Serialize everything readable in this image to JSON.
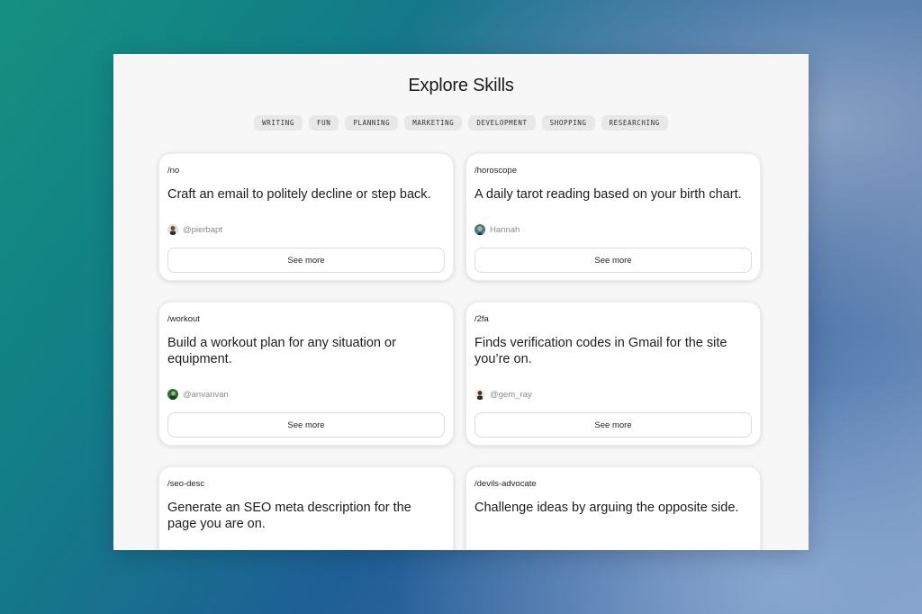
{
  "page": {
    "title": "Explore Skills"
  },
  "tags": [
    "WRITING",
    "FUN",
    "PLANNING",
    "MARKETING",
    "DEVELOPMENT",
    "SHOPPING",
    "RESEARCHING"
  ],
  "see_more_label": "See more",
  "cards": [
    {
      "command": "/no",
      "description": "Craft an email to politely decline or step back.",
      "author": "@pierbapt"
    },
    {
      "command": "/horoscope",
      "description": "A daily tarot reading based on your birth chart.",
      "author": "Hannah"
    },
    {
      "command": "/workout",
      "description": "Build a workout plan for any situation or equipment.",
      "author": "@anvanvan"
    },
    {
      "command": "/2fa",
      "description": "Finds verification codes in Gmail for the site you’re on.",
      "author": "@gem_ray"
    },
    {
      "command": "/seo-desc",
      "description": "Generate an SEO meta description for the page you are on.",
      "author": ""
    },
    {
      "command": "/devils-advocate",
      "description": "Challenge ideas by arguing the opposite side.",
      "author": ""
    }
  ],
  "colors": {
    "background_teal": "#14907f",
    "background_blue": "#1e5f96",
    "panel": "#f7f7f7",
    "tag_bg": "#e8e8e8"
  }
}
